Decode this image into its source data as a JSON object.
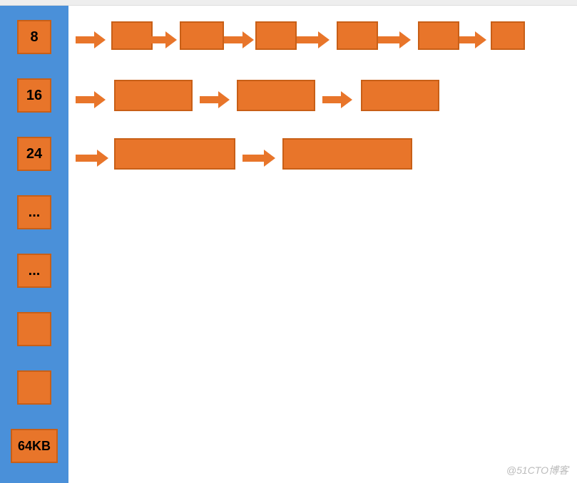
{
  "colors": {
    "sidebar": "#4a90d9",
    "block_fill": "#e8752a",
    "block_border": "#c85f17"
  },
  "sidebar": {
    "slots": [
      {
        "label": "8"
      },
      {
        "label": "16"
      },
      {
        "label": "24"
      },
      {
        "label": "..."
      },
      {
        "label": "..."
      },
      {
        "label": ""
      },
      {
        "label": ""
      },
      {
        "label": "64KB"
      }
    ]
  },
  "rows": [
    {
      "slot_index": 0,
      "block_count": 6
    },
    {
      "slot_index": 1,
      "block_count": 3
    },
    {
      "slot_index": 2,
      "block_count": 2
    }
  ],
  "watermark": "@51CTO博客"
}
